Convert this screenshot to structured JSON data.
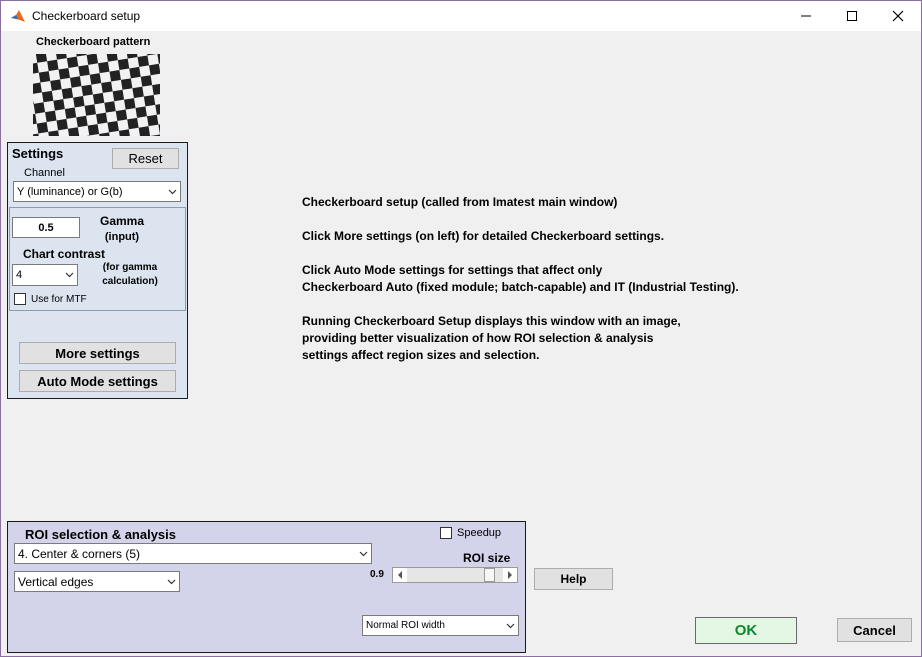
{
  "window": {
    "title": "Checkerboard setup"
  },
  "pattern": {
    "label": "Checkerboard pattern"
  },
  "settings": {
    "title": "Settings",
    "reset_label": "Reset",
    "channel_label": "Channel",
    "channel_value": "Y (luminance) or G(b)",
    "gamma_value": "0.5",
    "gamma_label_1": "Gamma",
    "gamma_label_2": "(input)",
    "chart_contrast_label": "Chart contrast",
    "chart_contrast_value": "4",
    "gamma_calc_1": "(for gamma",
    "gamma_calc_2": "calculation)",
    "use_for_mtf_label": "Use for MTF",
    "more_settings_label": "More settings",
    "auto_mode_label": "Auto Mode settings"
  },
  "info": {
    "line1": "Checkerboard setup  (called from Imatest main window)",
    "line2": "Click More settings (on left) for detailed Checkerboard settings.",
    "line3": "Click Auto Mode settings for settings that affect only",
    "line4": "Checkerboard Auto (fixed module; batch-capable) and IT (Industrial Testing).",
    "line5": "Running Checkerboard Setup displays this window with an image,",
    "line6": "providing better visualization of how ROI selection & analysis",
    "line7": "settings affect region sizes and selection."
  },
  "roi": {
    "title": "ROI selection & analysis",
    "speedup_label": "Speedup",
    "roi_size_label": "ROI size",
    "selection_value": "4.   Center & corners (5)",
    "edges_value": "Vertical edges",
    "size_value": "0.9",
    "size_fraction": 0.9,
    "width_value": "Normal ROI width"
  },
  "help_label": "Help",
  "ok_label": "OK",
  "cancel_label": "Cancel",
  "colors": {
    "settings_panel_bg": "#dbe4ef",
    "roi_panel_bg": "#d3d3ea",
    "ok_bg": "#e4f6e4",
    "ok_text": "#0a8a2a"
  },
  "icons": {
    "app": "matlab-icon",
    "minimize": "minimize-icon",
    "maximize": "maximize-icon",
    "close": "close-icon",
    "dropdown": "chevron-down-icon"
  }
}
